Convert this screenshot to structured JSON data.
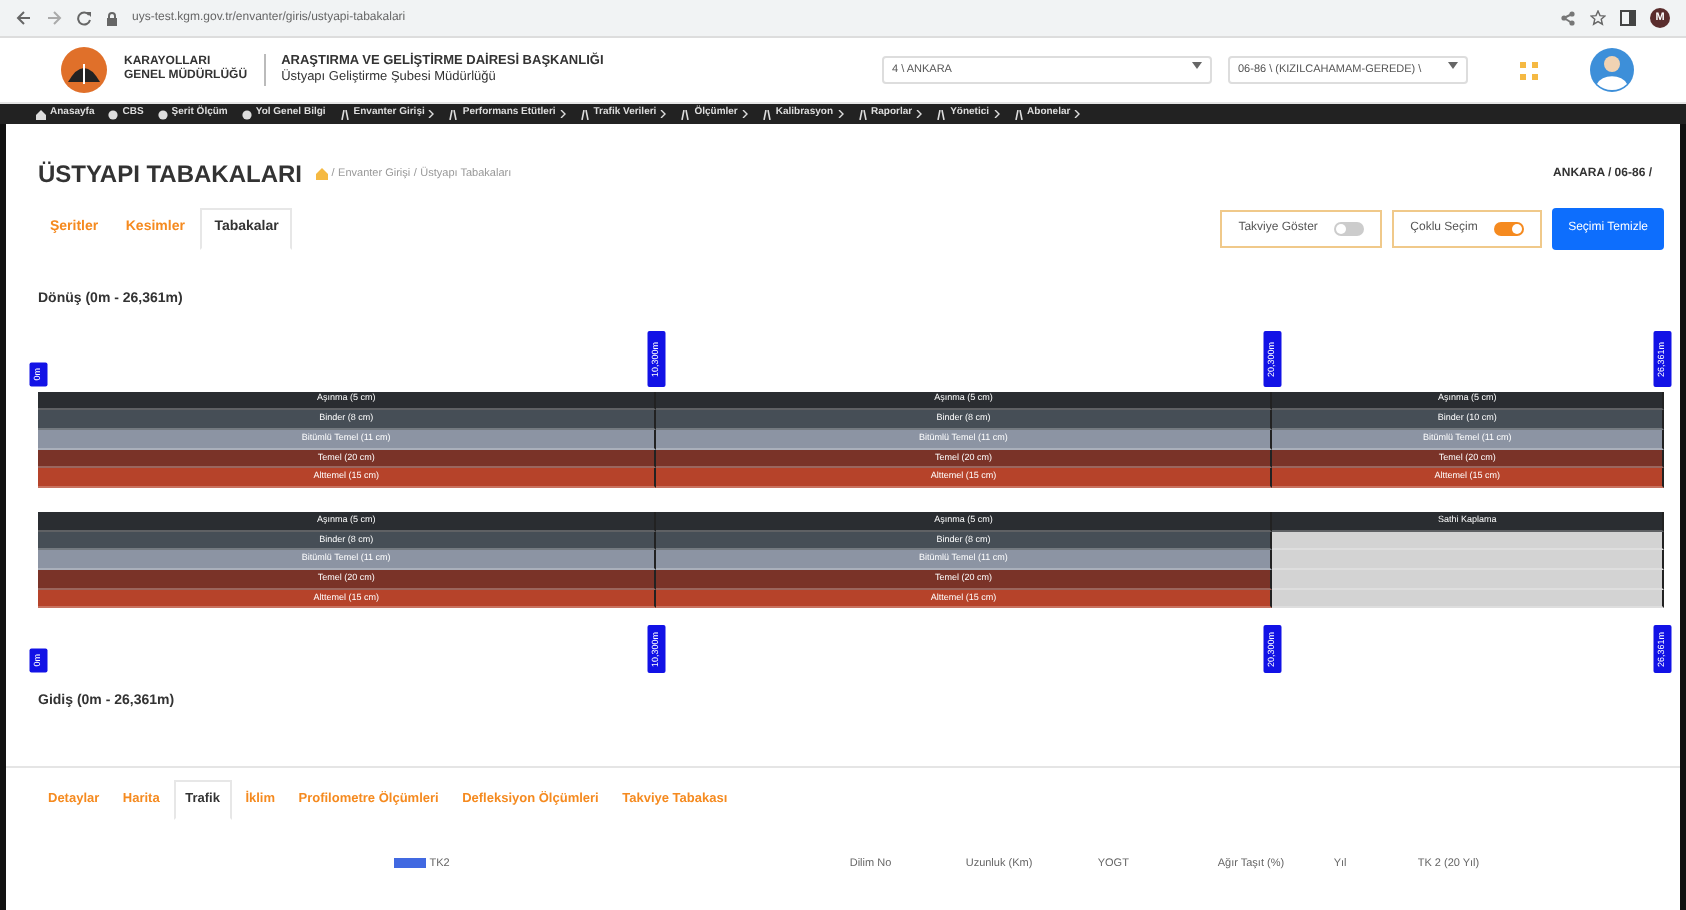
{
  "browser": {
    "url": "uys-test.kgm.gov.tr/envanter/giris/ustyapi-tabakalari",
    "profile": "M"
  },
  "header": {
    "org_line1": "KARAYOLLARI",
    "org_line2": "GENEL MÜDÜRLÜĞÜ",
    "dept": "ARAŞTIRMA VE GELİŞTİRME DAİRESİ BAŞKANLIĞI",
    "unit": "Üstyapı Geliştirme Şubesi Müdürlüğü",
    "region_select": "4 \\ ANKARA",
    "road_select": "06-86 \\ (KIZILCAHAMAM-GEREDE) \\"
  },
  "menu": [
    {
      "label": "Anasayfa",
      "submenu": false
    },
    {
      "label": "CBS",
      "submenu": false
    },
    {
      "label": "Şerit Ölçüm",
      "submenu": false
    },
    {
      "label": "Yol Genel Bilgi",
      "submenu": false
    },
    {
      "label": "Envanter Girişi",
      "submenu": true
    },
    {
      "label": "Performans Etütleri",
      "submenu": true
    },
    {
      "label": "Trafik Verileri",
      "submenu": true
    },
    {
      "label": "Ölçümler",
      "submenu": true
    },
    {
      "label": "Kalibrasyon",
      "submenu": true
    },
    {
      "label": "Raporlar",
      "submenu": true
    },
    {
      "label": "Yönetici",
      "submenu": true
    },
    {
      "label": "Abonelar",
      "submenu": true
    }
  ],
  "page": {
    "title": "ÜSTYAPI TABAKALARI",
    "breadcrumb": [
      "Envanter Girişi",
      "Üstyapı Tabakaları"
    ],
    "breadcrumb_separator": "/",
    "location": "ANKARA / 06-86 /"
  },
  "tabs": [
    {
      "label": "Şeritler",
      "selected": false
    },
    {
      "label": "Kesimler",
      "selected": false
    },
    {
      "label": "Tabakalar",
      "selected": true
    }
  ],
  "toggles": [
    {
      "label": "Takviye Göster",
      "on": false
    },
    {
      "label": "Çoklu Seçim",
      "on": true
    }
  ],
  "clear_button": "Seçimi Temizle",
  "donus_label": "Dönüş (0m - 26,361m)",
  "top_markers": [
    "0m",
    "10,300m",
    "20,300m",
    "26,361m"
  ],
  "lanes": [
    {
      "segments": [
        {
          "layers": [
            {
              "label": "Aşınma (5 cm)",
              "kind": "asinma"
            },
            {
              "label": "Binder (8 cm)",
              "kind": "binder"
            },
            {
              "label": "Bitümlü Temel (11 cm)",
              "kind": "bitumlu"
            },
            {
              "label": "Temel (20 cm)",
              "kind": "temel"
            },
            {
              "label": "Alttemel (15 cm)",
              "kind": "alttemel"
            }
          ]
        },
        {
          "layers": [
            {
              "label": "Aşınma (5 cm)",
              "kind": "asinma"
            },
            {
              "label": "Binder (8 cm)",
              "kind": "binder"
            },
            {
              "label": "Bitümlü Temel (11 cm)",
              "kind": "bitumlu"
            },
            {
              "label": "Temel (20 cm)",
              "kind": "temel"
            },
            {
              "label": "Alttemel (15 cm)",
              "kind": "alttemel"
            }
          ]
        },
        {
          "layers": [
            {
              "label": "Aşınma (5 cm)",
              "kind": "asinma"
            },
            {
              "label": "Binder (10 cm)",
              "kind": "binder"
            },
            {
              "label": "Bitümlü Temel (11 cm)",
              "kind": "bitumlu"
            },
            {
              "label": "Temel (20 cm)",
              "kind": "temel"
            },
            {
              "label": "Alttemel (15 cm)",
              "kind": "alttemel"
            }
          ]
        }
      ]
    },
    {
      "segments": [
        {
          "layers": [
            {
              "label": "Aşınma (5 cm)",
              "kind": "asinma"
            },
            {
              "label": "Binder (8 cm)",
              "kind": "binder"
            },
            {
              "label": "Bitümlü Temel (11 cm)",
              "kind": "bitumlu"
            },
            {
              "label": "Temel (20 cm)",
              "kind": "temel"
            },
            {
              "label": "Alttemel (15 cm)",
              "kind": "alttemel"
            }
          ]
        },
        {
          "layers": [
            {
              "label": "Aşınma (5 cm)",
              "kind": "asinma"
            },
            {
              "label": "Binder (8 cm)",
              "kind": "binder"
            },
            {
              "label": "Bitümlü Temel (11 cm)",
              "kind": "bitumlu"
            },
            {
              "label": "Temel (20 cm)",
              "kind": "temel"
            },
            {
              "label": "Alttemel (15 cm)",
              "kind": "alttemel"
            }
          ]
        },
        {
          "layers": [
            {
              "label": "Sathi Kaplama",
              "kind": "asinma"
            },
            {
              "kind": "empty"
            },
            {
              "kind": "empty"
            },
            {
              "kind": "empty"
            },
            {
              "kind": "empty"
            }
          ]
        }
      ]
    }
  ],
  "bottom_markers": [
    "0m",
    "10,300m",
    "20,300m",
    "26,361m"
  ],
  "gidis_label": "Gidiş (0m - 26,361m)",
  "detail_tabs": [
    {
      "label": "Detaylar",
      "selected": false
    },
    {
      "label": "Harita",
      "selected": false
    },
    {
      "label": "Trafik",
      "selected": true
    },
    {
      "label": "İklim",
      "selected": false
    },
    {
      "label": "Profilometre Ölçümleri",
      "selected": false
    },
    {
      "label": "Defleksiyon Ölçümleri",
      "selected": false
    },
    {
      "label": "Takviye Tabakası",
      "selected": false
    }
  ],
  "legend": {
    "label": "TK2",
    "color": "#4169e1"
  },
  "table": {
    "columns": [
      "Dilim No",
      "Uzunluk (Km)",
      "YOGT",
      "Ağır Taşıt (%)",
      "Yıl",
      "TK 2 (20 Yıl)"
    ]
  }
}
